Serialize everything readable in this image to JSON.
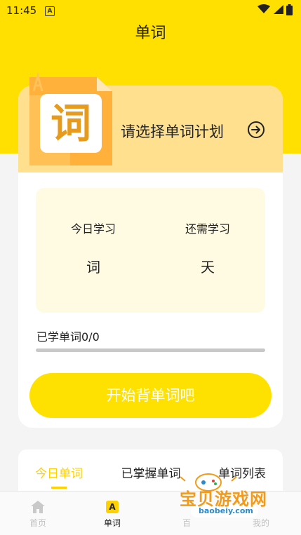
{
  "status_bar": {
    "time": "11:45",
    "notification_icon": "A"
  },
  "header": {
    "title": "单词"
  },
  "plan": {
    "tile_glyph": "词",
    "label": "请选择单词计划"
  },
  "stats": {
    "today_label": "今日学习",
    "today_value": "词",
    "remaining_label": "还需学习",
    "remaining_value": "天"
  },
  "progress": {
    "label": "已学单词0/0",
    "fraction": 0
  },
  "start_button": {
    "label": "开始背单词吧"
  },
  "tabs": [
    {
      "label": "今日单词",
      "active": true
    },
    {
      "label": "已掌握单词",
      "active": false
    },
    {
      "label": "单词列表",
      "active": false
    }
  ],
  "bottom_nav": [
    {
      "label": "首页",
      "icon": "home-icon"
    },
    {
      "label": "单词",
      "icon": "word-icon",
      "active": true
    },
    {
      "label": "百",
      "icon": ""
    },
    {
      "label": "我的",
      "icon": ""
    }
  ],
  "watermark": {
    "text": "宝贝游戏网",
    "url": "baobeiy.com"
  },
  "colors": {
    "accent": "#ffe000",
    "banner": "#ffe08f",
    "tab_active": "#ffd100"
  }
}
